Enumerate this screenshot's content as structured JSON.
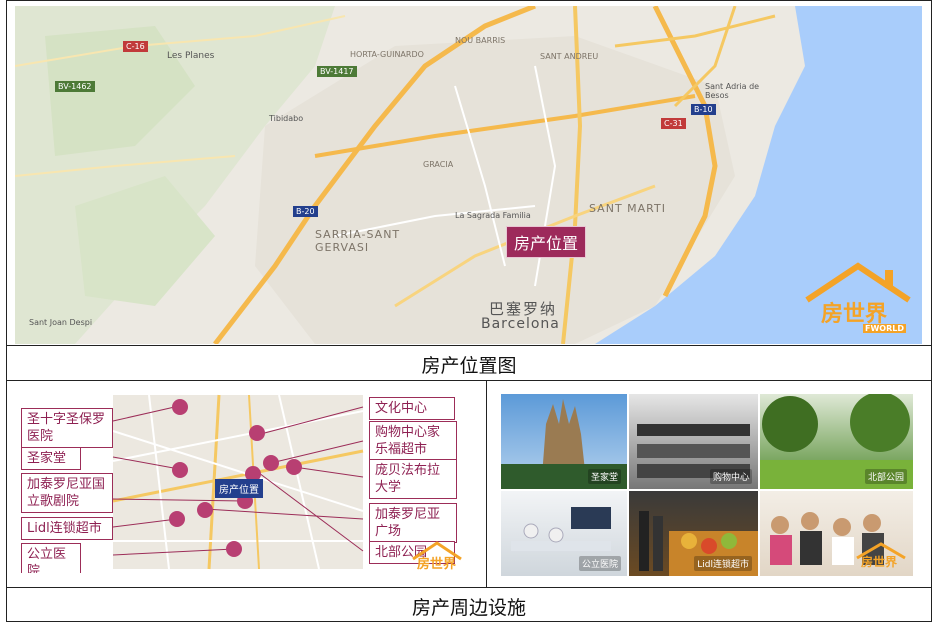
{
  "top_map": {
    "marker_label": "房产位置",
    "city_cn": "巴塞罗纳",
    "city_en": "Barcelona",
    "districts": [
      "SARRIA-SANT GERVASI",
      "SANT MARTI",
      "GRACIA",
      "NOU BARRIS",
      "SANT ANDREU",
      "HORTA-GUINARDO"
    ],
    "places": [
      "Les Planes",
      "Tibidabo",
      "La Sagrada Familia",
      "Sant Adria de Besos",
      "Sant Joan Despi"
    ],
    "road_labels": [
      "BV-1462",
      "B-20",
      "BV-1417",
      "C-16",
      "B-10",
      "C-31"
    ]
  },
  "captions": {
    "top": "房产位置图",
    "bottom": "房产周边设施"
  },
  "amenities_left": [
    "圣十字圣保罗医院",
    "圣家堂",
    "加泰罗尼亚国立歌剧院",
    "Lidl连锁超市",
    "公立医院"
  ],
  "amenities_right": [
    "文化中心",
    "购物中心家乐福超市",
    "庞贝法布拉大学",
    "加泰罗尼亚广场",
    "北部公园"
  ],
  "small_map_label": "房产位置",
  "photos": [
    {
      "label": "圣家堂"
    },
    {
      "label": "购物中心"
    },
    {
      "label": "北部公园"
    },
    {
      "label": "公立医院"
    },
    {
      "label": "Lidl连锁超市"
    },
    {
      "label": ""
    }
  ],
  "logo": {
    "cn": "房世界",
    "en": "FWORLD"
  },
  "colors": {
    "marker": "#9d2a5b",
    "sea": "#a9cdfb",
    "land": "#ece9e2",
    "highway": "#f5b94c",
    "logo": "#f4a327"
  }
}
